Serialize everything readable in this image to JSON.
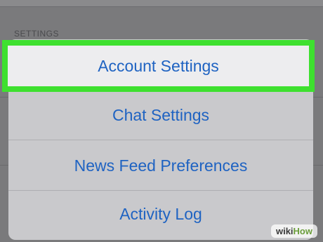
{
  "background": {
    "section_label": "SETTINGS"
  },
  "menu": {
    "items": [
      {
        "label": "Account Settings",
        "highlighted": true
      },
      {
        "label": "Chat Settings"
      },
      {
        "label": "News Feed Preferences"
      },
      {
        "label": "Activity Log"
      }
    ]
  },
  "watermark": {
    "prefix": "wiki",
    "suffix": "How"
  },
  "colors": {
    "highlight_border": "#3ee02f",
    "action_text": "#1f63c2",
    "sheet": "#c9c9cc",
    "dimmed_background": "#7a7a7c"
  }
}
